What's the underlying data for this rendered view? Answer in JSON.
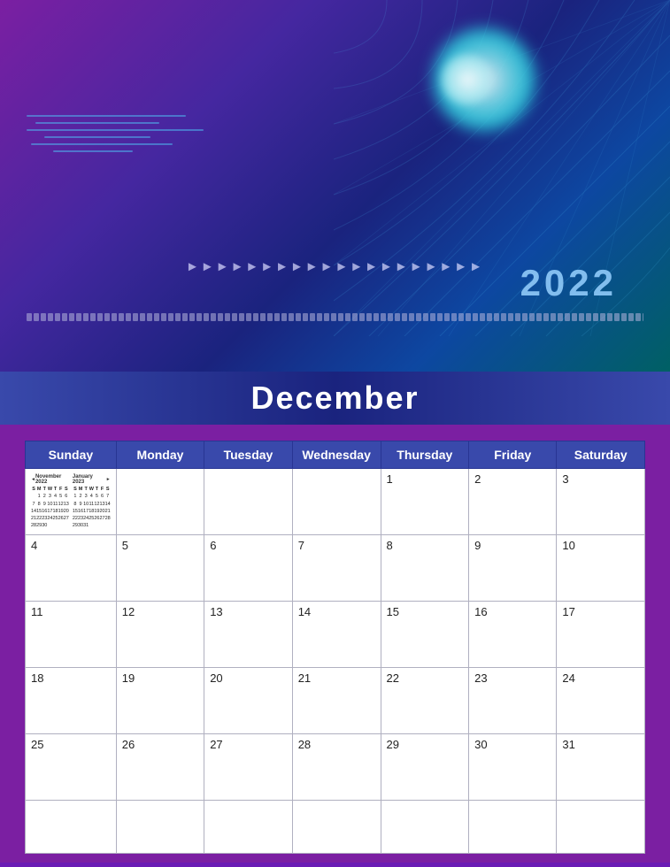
{
  "header": {
    "year": "2022",
    "month": "December"
  },
  "calendar": {
    "days_of_week": [
      "Sunday",
      "Monday",
      "Tuesday",
      "Wednesday",
      "Thursday",
      "Friday",
      "Saturday"
    ],
    "weeks": [
      [
        "",
        "",
        "",
        "",
        "1",
        "2",
        "3"
      ],
      [
        "4",
        "5",
        "6",
        "7",
        "8",
        "9",
        "10"
      ],
      [
        "11",
        "12",
        "13",
        "14",
        "15",
        "16",
        "17"
      ],
      [
        "18",
        "19",
        "20",
        "21",
        "22",
        "23",
        "24"
      ],
      [
        "25",
        "26",
        "27",
        "28",
        "29",
        "30",
        "31"
      ],
      [
        "",
        "",
        "",
        "",
        "",
        "",
        ""
      ]
    ],
    "mini_nov": {
      "title": "November 2022",
      "days": [
        "S",
        "M",
        "T",
        "W",
        "T",
        "F",
        "S"
      ],
      "rows": [
        [
          "",
          "1",
          "2",
          "3",
          "4",
          "5"
        ],
        [
          "6",
          "7",
          "8",
          "9",
          "10",
          "11",
          "12"
        ],
        [
          "13",
          "14",
          "15",
          "16",
          "17",
          "18",
          "19"
        ],
        [
          "20",
          "21",
          "22",
          "23",
          "24",
          "25",
          "26"
        ],
        [
          "27",
          "28",
          "29",
          "30",
          "",
          "",
          ""
        ]
      ]
    },
    "mini_jan": {
      "title": "January 2023",
      "days": [
        "S",
        "M",
        "T",
        "W",
        "T",
        "F",
        "S"
      ],
      "rows": [
        [
          "1",
          "2",
          "3",
          "4",
          "5",
          "6",
          "7"
        ],
        [
          "8",
          "9",
          "10",
          "11",
          "12",
          "13",
          "14"
        ],
        [
          "15",
          "16",
          "17",
          "18",
          "19",
          "20",
          "21"
        ],
        [
          "22",
          "23",
          "24",
          "25",
          "26",
          "27",
          "28"
        ],
        [
          "29",
          "30",
          "31",
          "",
          "",
          "",
          ""
        ]
      ]
    }
  }
}
